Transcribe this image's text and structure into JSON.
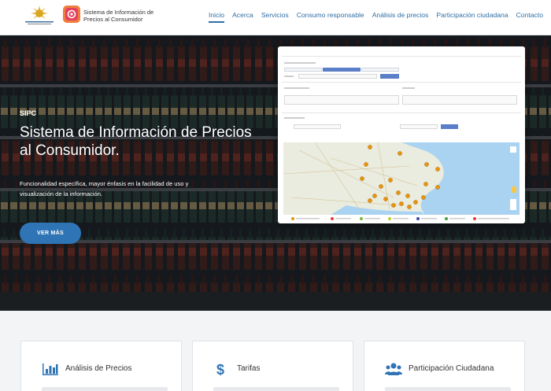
{
  "header": {
    "brand_line1": "Sistema de Información de",
    "brand_line2": "Precios al Consumidor",
    "nav": [
      {
        "label": "Inicio",
        "active": true
      },
      {
        "label": "Acerca"
      },
      {
        "label": "Servicios"
      },
      {
        "label": "Consumo responsable"
      },
      {
        "label": "Análisis de precios"
      },
      {
        "label": "Participación ciudadana"
      },
      {
        "label": "Contacto"
      }
    ]
  },
  "hero": {
    "eyebrow": "SIPC",
    "title": "Sistema de Información de Precios al Consumidor.",
    "description": "Funcionalidad específica, mayor énfasis en la facilidad de uso y visualización de la información.",
    "button": "VER MÁS"
  },
  "cards": [
    {
      "title": "Análisis de Precios",
      "icon": "bar-chart-icon"
    },
    {
      "title": "Tarifas",
      "icon": "dollar-icon"
    },
    {
      "title": "Participación Ciudadana",
      "icon": "users-icon"
    }
  ],
  "colors": {
    "accent": "#2f75b5",
    "nav": "#2f6fa6",
    "marker": "#e8940f"
  }
}
